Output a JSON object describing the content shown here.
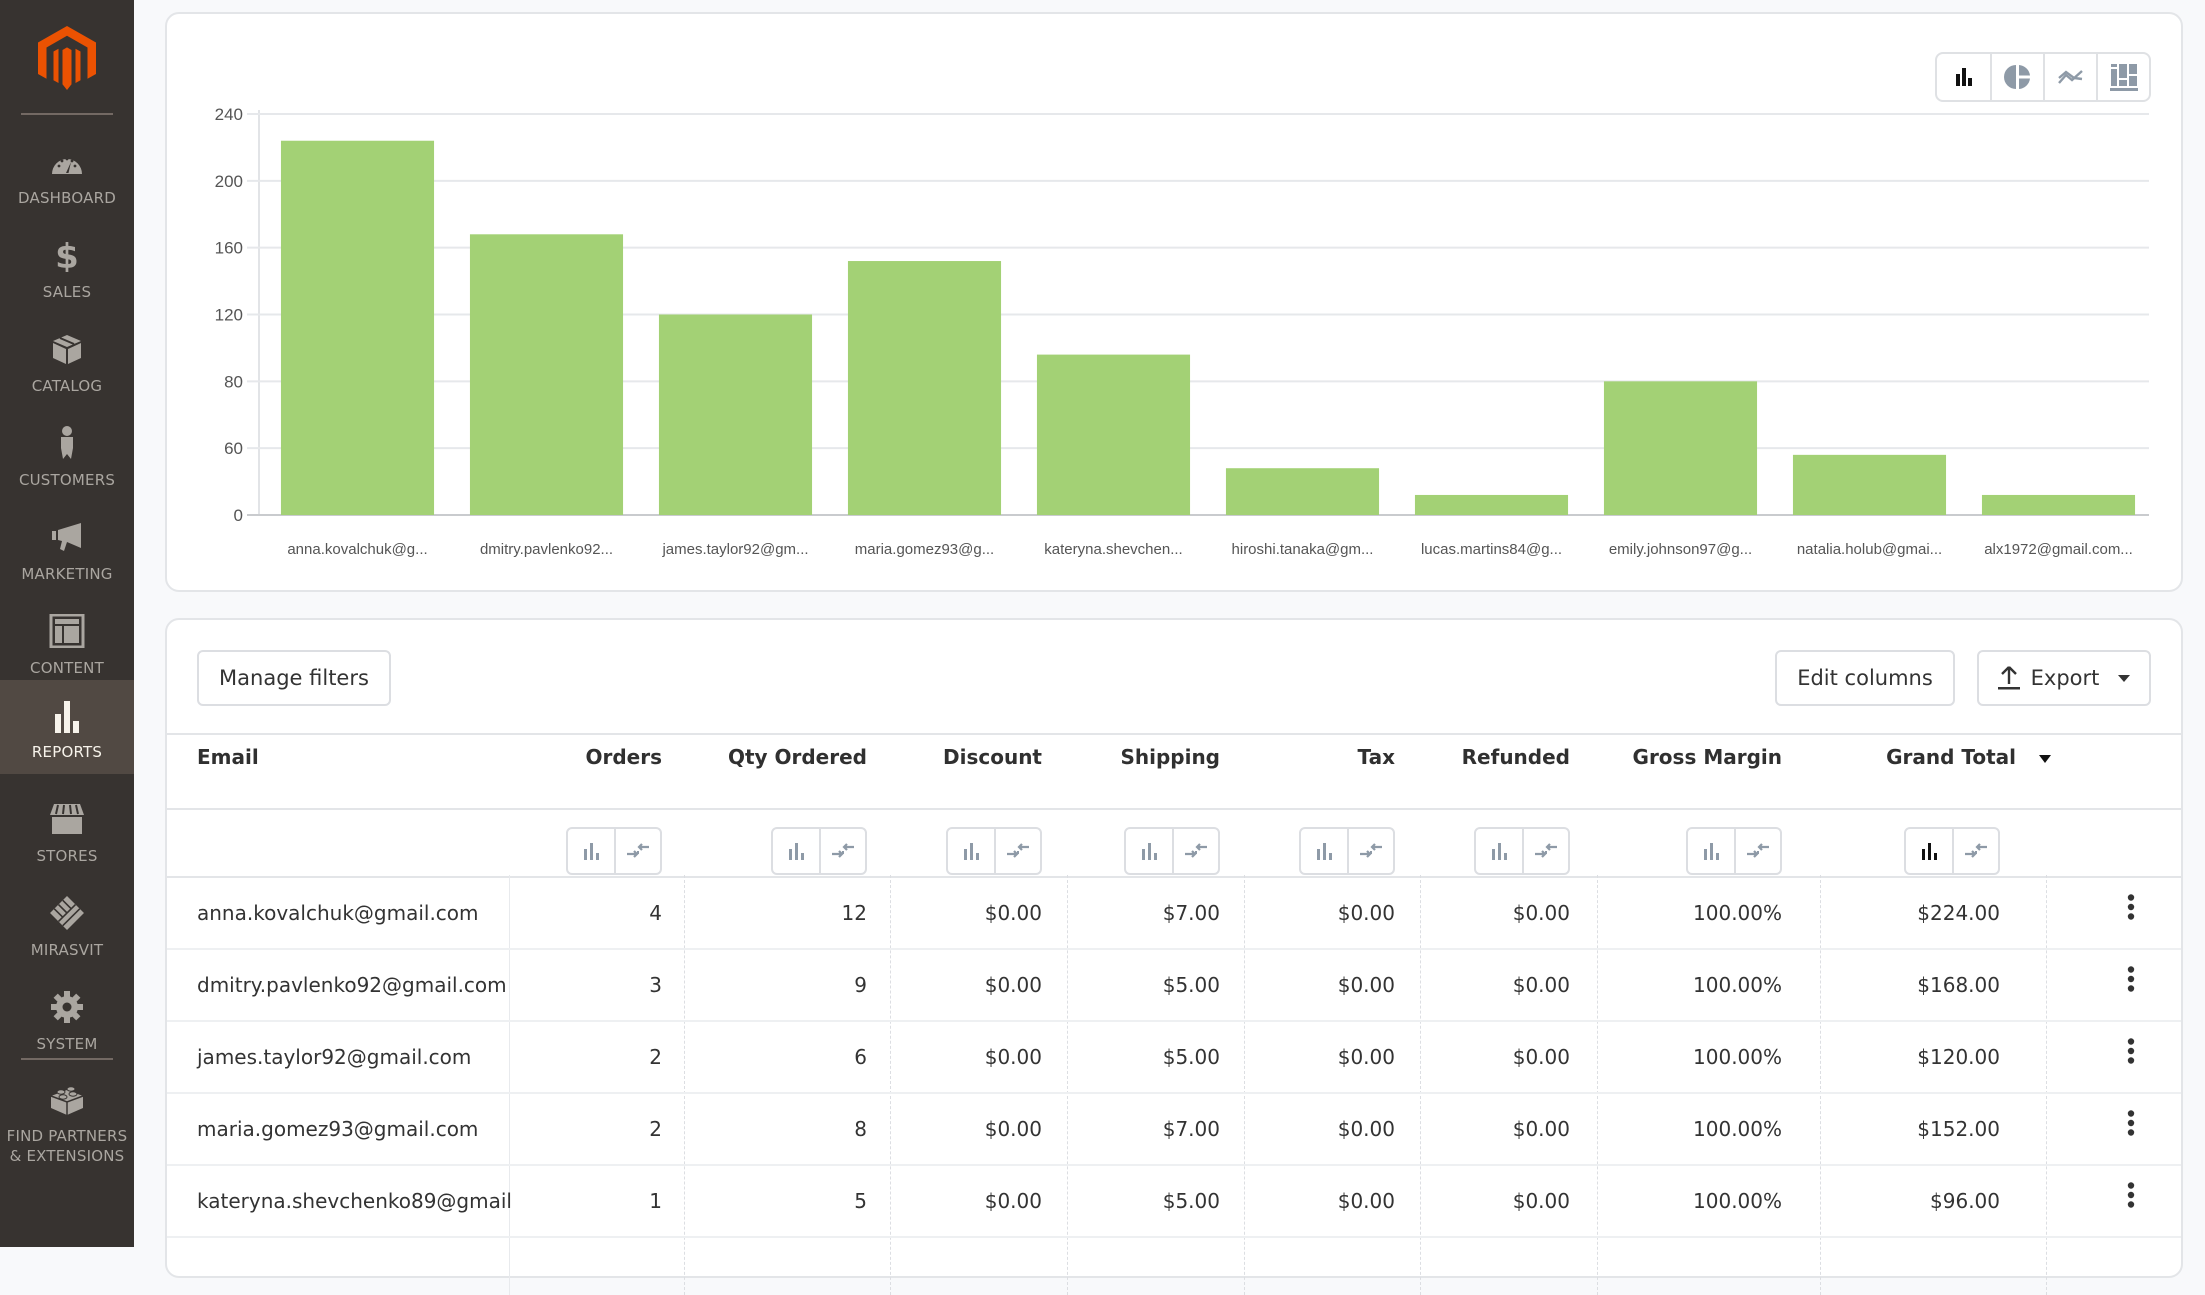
{
  "sidebar": {
    "items": [
      {
        "label": "DASHBOARD",
        "icon": "gauge-icon"
      },
      {
        "label": "SALES",
        "icon": "dollar-icon"
      },
      {
        "label": "CATALOG",
        "icon": "box-icon"
      },
      {
        "label": "CUSTOMERS",
        "icon": "person-icon"
      },
      {
        "label": "MARKETING",
        "icon": "megaphone-icon"
      },
      {
        "label": "CONTENT",
        "icon": "layout-icon"
      },
      {
        "label": "REPORTS",
        "icon": "bar-chart-icon",
        "active": true
      },
      {
        "label": "STORES",
        "icon": "storefront-icon"
      },
      {
        "label": "MIRASVIT",
        "icon": "mirasvit-icon"
      },
      {
        "label": "SYSTEM",
        "icon": "gear-icon"
      },
      {
        "label_line1": "FIND PARTNERS",
        "label_line2": "& EXTENSIONS",
        "icon": "lego-brick-icon"
      }
    ]
  },
  "chart_switcher": [
    "column-chart",
    "pie-chart",
    "line-chart",
    "stacked-chart"
  ],
  "chart_data": {
    "type": "bar",
    "title": "",
    "xlabel": "",
    "ylabel": "",
    "categories": [
      "anna.kovalchuk@g...",
      "dmitry.pavlenko92...",
      "james.taylor92@gm...",
      "maria.gomez93@g...",
      "kateryna.shevchen...",
      "hiroshi.tanaka@gm...",
      "lucas.martins84@g...",
      "emily.johnson97@g...",
      "natalia.holub@gmai...",
      "alx1972@gmail.com..."
    ],
    "values": [
      224,
      168,
      120,
      152,
      96,
      28,
      12,
      80,
      36,
      12
    ],
    "y_tick_labels": [
      "0",
      "60",
      "80",
      "120",
      "160",
      "200",
      "240"
    ],
    "y_tick_values": [
      0,
      40,
      80,
      120,
      160,
      200,
      240
    ],
    "ylim": [
      0,
      240
    ],
    "grid": true,
    "bar_color": "#a3d175",
    "legend": "none"
  },
  "toolbar": {
    "manage_filters": "Manage filters",
    "edit_columns": "Edit columns",
    "export": "Export"
  },
  "table": {
    "columns": [
      "Email",
      "Orders",
      "Qty Ordered",
      "Discount",
      "Shipping",
      "Tax",
      "Refunded",
      "Gross Margin",
      "Grand Total"
    ],
    "sorted_column": "Grand Total",
    "sort_direction": "desc",
    "active_chart_column": "Grand Total",
    "rows": [
      [
        "anna.kovalchuk@gmail.com",
        "4",
        "12",
        "$0.00",
        "$7.00",
        "$0.00",
        "$0.00",
        "100.00%",
        "$224.00"
      ],
      [
        "dmitry.pavlenko92@gmail.com",
        "3",
        "9",
        "$0.00",
        "$5.00",
        "$0.00",
        "$0.00",
        "100.00%",
        "$168.00"
      ],
      [
        "james.taylor92@gmail.com",
        "2",
        "6",
        "$0.00",
        "$5.00",
        "$0.00",
        "$0.00",
        "100.00%",
        "$120.00"
      ],
      [
        "maria.gomez93@gmail.com",
        "2",
        "8",
        "$0.00",
        "$7.00",
        "$0.00",
        "$0.00",
        "100.00%",
        "$152.00"
      ],
      [
        "kateryna.shevchenko89@gmail",
        "1",
        "5",
        "$0.00",
        "$5.00",
        "$0.00",
        "$0.00",
        "100.00%",
        "$96.00"
      ]
    ]
  },
  "colors": {
    "sidebar_bg": "#373330",
    "sidebar_active": "#514943",
    "brand_orange": "#eb5202",
    "bar_green": "#a3d175"
  }
}
